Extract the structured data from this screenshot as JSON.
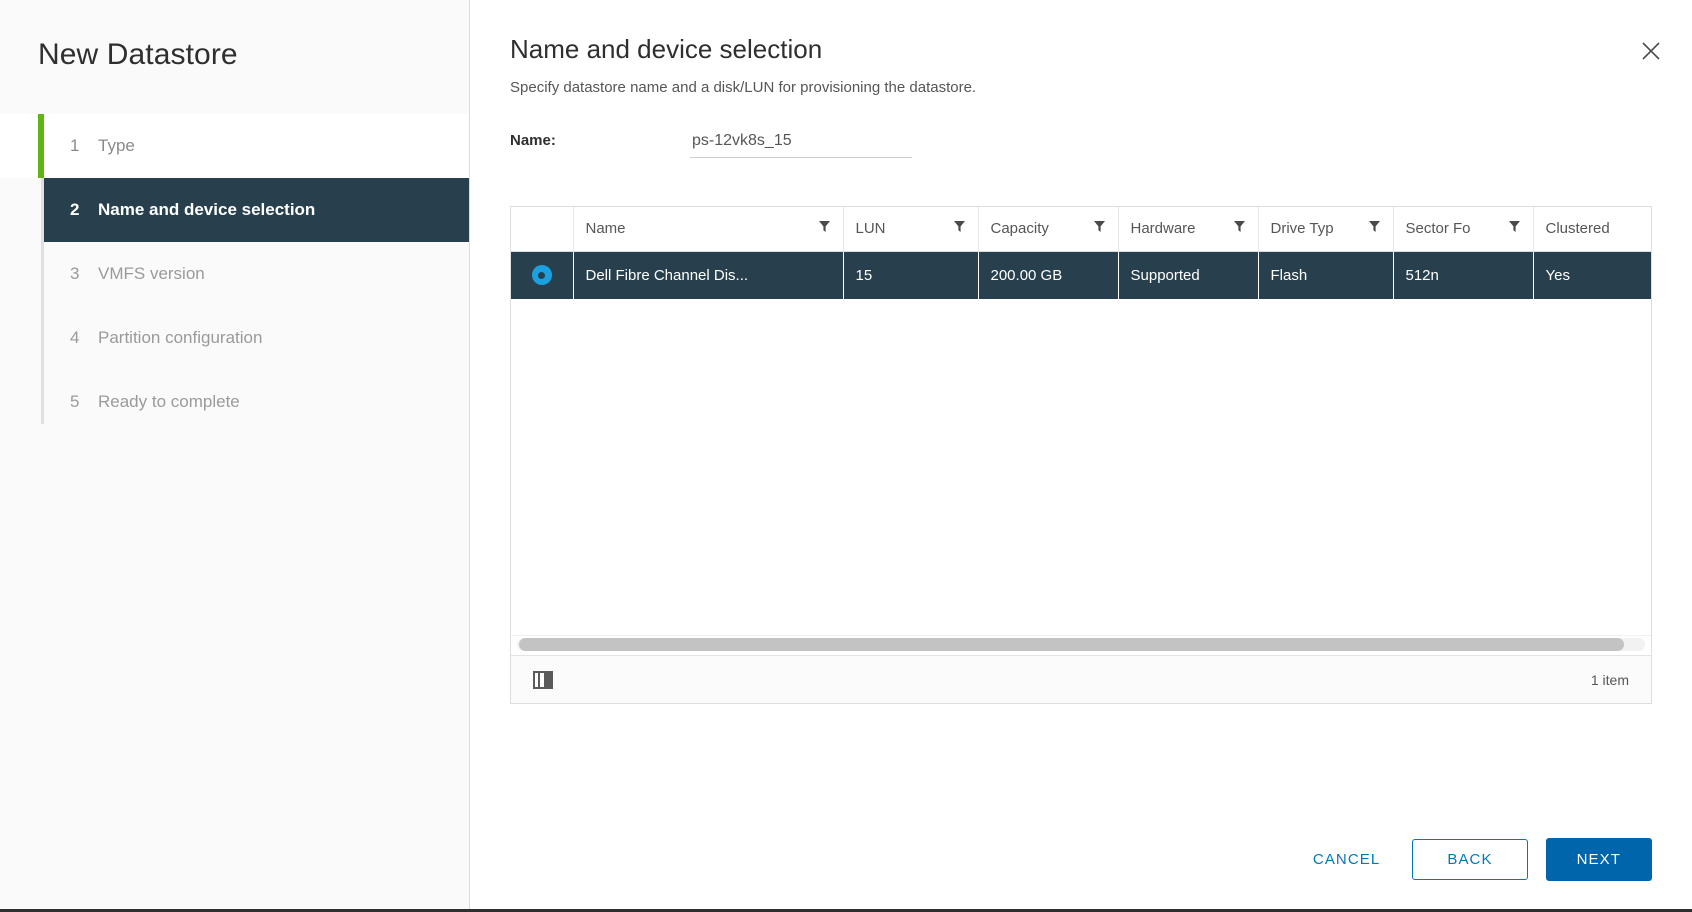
{
  "wizard": {
    "title": "New Datastore",
    "steps": [
      {
        "num": "1",
        "label": "Type",
        "state": "done"
      },
      {
        "num": "2",
        "label": "Name and device selection",
        "state": "current"
      },
      {
        "num": "3",
        "label": "VMFS version",
        "state": "pending"
      },
      {
        "num": "4",
        "label": "Partition configuration",
        "state": "pending"
      },
      {
        "num": "5",
        "label": "Ready to complete",
        "state": "pending"
      }
    ]
  },
  "page": {
    "title": "Name and device selection",
    "subtitle": "Specify datastore name and a disk/LUN for provisioning the datastore.",
    "close_icon": "close-icon"
  },
  "form": {
    "name_label": "Name:",
    "name_value": "ps-12vk8s_15",
    "name_placeholder": "Enter datastore name"
  },
  "table": {
    "columns": [
      {
        "key": "select",
        "label": "",
        "filter": false
      },
      {
        "key": "name",
        "label": "Name",
        "filter": true
      },
      {
        "key": "lun",
        "label": "LUN",
        "filter": true
      },
      {
        "key": "capacity",
        "label": "Capacity",
        "filter": true
      },
      {
        "key": "hardware",
        "label": "Hardware",
        "filter": true
      },
      {
        "key": "drive_type",
        "label": "Drive Typ",
        "filter": true
      },
      {
        "key": "sector_format",
        "label": "Sector Fo",
        "filter": true
      },
      {
        "key": "clustered",
        "label": "Clustered",
        "filter": true
      }
    ],
    "rows": [
      {
        "selected": true,
        "name": "Dell Fibre Channel Dis...",
        "lun": "15",
        "capacity": "200.00 GB",
        "hardware": "Supported",
        "drive_type": "Flash",
        "sector_format": "512n",
        "clustered": "Yes"
      }
    ],
    "footer": {
      "column_picker_icon": "columns-icon",
      "item_count": "1 item"
    }
  },
  "footer": {
    "cancel_label": "CANCEL",
    "back_label": "BACK",
    "next_label": "NEXT"
  },
  "colors": {
    "accent_done": "#60b515",
    "selected_bg": "#28404d",
    "primary": "#0065ab",
    "link": "#0079b8",
    "radio": "#1ba0e1"
  }
}
